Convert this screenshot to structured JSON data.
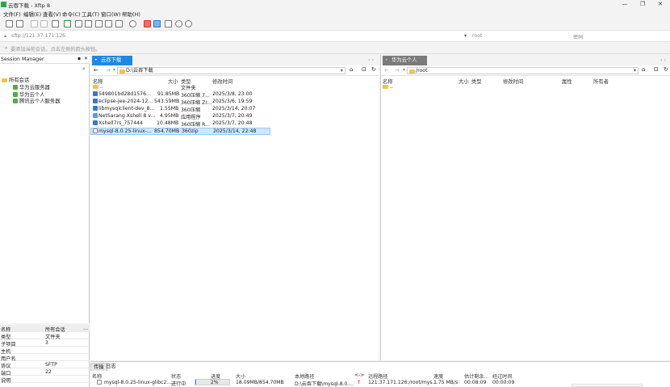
{
  "window": {
    "title": "云吞下载 - Xftp 8"
  },
  "menu": [
    "文件(F)",
    "编辑(E)",
    "查看(V)",
    "命令(C)",
    "工具(T)",
    "窗口(W)",
    "帮助(H)"
  ],
  "address": {
    "url": "sftp://121.37.171.126",
    "user": "root",
    "password_placeholder": "密码"
  },
  "hint": "要添加当前会话，点击左侧的箭头按钮。",
  "session_manager": {
    "title": "Session Manager",
    "tree": [
      {
        "label": "所有会话",
        "level": 0,
        "type": "folder"
      },
      {
        "label": "华为云服务器",
        "level": 1,
        "type": "server"
      },
      {
        "label": "华为云个人",
        "level": 1,
        "type": "server"
      },
      {
        "label": "腾讯云个人服务器",
        "level": 1,
        "type": "server"
      }
    ]
  },
  "properties": [
    {
      "key": "名称",
      "value": "所有会话"
    },
    {
      "key": "类型",
      "value": "文件夹"
    },
    {
      "key": "子项目",
      "value": "3"
    },
    {
      "key": "主机",
      "value": ""
    },
    {
      "key": "用户名",
      "value": ""
    },
    {
      "key": "协议",
      "value": "SFTP"
    },
    {
      "key": "端口",
      "value": "22"
    },
    {
      "key": "说明",
      "value": ""
    }
  ],
  "local": {
    "tab": "云吞下载",
    "path": "D:\\云吞下载",
    "columns": [
      "名称",
      "大小",
      "类型",
      "修改时间"
    ],
    "parent": {
      "name": "..",
      "type": "文件夹"
    },
    "files": [
      {
        "name": "549801bd28d1576...",
        "size": "91.85MB",
        "type": "360压缩 7...",
        "date": "2025/3/8, 23:00"
      },
      {
        "name": "eclipse-jee-2024-12...",
        "size": "543.59MB",
        "type": "360压缩 ZI...",
        "date": "2025/3/6, 19:59"
      },
      {
        "name": "libmysqlclient-dev_8...",
        "size": "1.55MB",
        "type": "360压缩",
        "date": "2025/3/14, 20:07"
      },
      {
        "name": "NetSarang Xshell 8 v...",
        "size": "4.95MB",
        "type": "应用程序",
        "date": "2025/3/7, 20:49"
      },
      {
        "name": "Xshell7rs_757444",
        "size": "10.48MB",
        "type": "360压缩 R...",
        "date": "2025/3/7, 20:48"
      },
      {
        "name": "mysql-8.0.25-linux-...",
        "size": "854.70MB",
        "type": "360zip",
        "date": "2025/3/14, 22:48"
      }
    ]
  },
  "remote": {
    "tab": "华为云个人",
    "path": "/root",
    "columns": [
      "名称",
      "大小",
      "类型",
      "修改时间",
      "属性",
      "所有者"
    ],
    "parent": {
      "name": ".."
    }
  },
  "transfer": {
    "tabs": [
      "传输",
      "日志"
    ],
    "columns": [
      "名称",
      "状态",
      "进度",
      "大小",
      "本地路径",
      "<->",
      "远程路径",
      "速度",
      "估计剩余...",
      "经过时间"
    ],
    "row": {
      "name": "mysql-8.0.25-linux-glibc2....",
      "status": "进行中",
      "progress": "2%",
      "progress_value": 0.02,
      "size": "18.09MB/854.70MB",
      "local": "D:\\云吞下载\\mysql-8.0....",
      "dir": "↑",
      "remote": "121.37.171.126:/root/mys...",
      "speed": "1.75 MB/s",
      "eta": "00:08:09",
      "elapsed": "00:00:09"
    }
  },
  "colors": {
    "local_tab": "#1e88e5",
    "remote_tab": "#7a7a7a",
    "selected_row": "#cce8ff",
    "upload_arrow": "#e53935"
  }
}
